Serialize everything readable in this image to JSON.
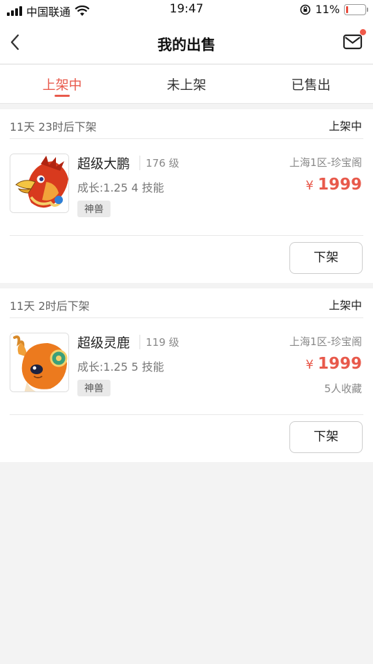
{
  "status_bar": {
    "carrier": "中国联通",
    "time": "19:47",
    "battery_percent": "11%",
    "battery_level": 0.11
  },
  "nav": {
    "title": "我的出售",
    "back_icon": "chevron-left-icon",
    "mail_icon": "mail-icon",
    "has_notification": true
  },
  "tabs": [
    {
      "label": "上架中",
      "active": true
    },
    {
      "label": "未上架",
      "active": false
    },
    {
      "label": "已售出",
      "active": false
    }
  ],
  "accent_color": "#e8594b",
  "listings": [
    {
      "deadline": "11天 23时后下架",
      "status": "上架中",
      "name": "超级大鹏",
      "level": "176 级",
      "growth": "成长:1.25  4 技能",
      "tag": "神兽",
      "server": "上海1区-珍宝阁",
      "currency": "¥",
      "price": "1999",
      "favorites": "",
      "action": "下架",
      "image": "phoenix-pet-image"
    },
    {
      "deadline": "11天 2时后下架",
      "status": "上架中",
      "name": "超级灵鹿",
      "level": "119 级",
      "growth": "成长:1.25  5 技能",
      "tag": "神兽",
      "server": "上海1区-珍宝阁",
      "currency": "¥",
      "price": "1999",
      "favorites": "5人收藏",
      "action": "下架",
      "image": "deer-pet-image"
    }
  ]
}
